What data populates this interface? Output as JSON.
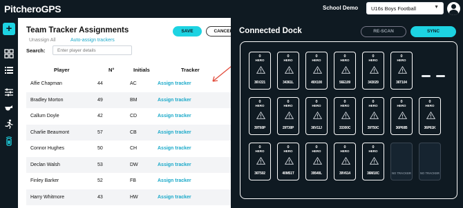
{
  "header": {
    "logo_text": "PitcheroGPS",
    "school": "School Demo",
    "team_selected": "U16s Boys Football"
  },
  "left_panel": {
    "title": "Team Tracker Assignments",
    "save_label": "SAVE",
    "cancel_label": "CANCEL",
    "unassign_label": "Unassign All",
    "auto_assign_label": "Auto-assign trackers",
    "search_label": "Search:",
    "search_placeholder": "Enter player details",
    "columns": [
      "Player",
      "N°",
      "Initials",
      "Tracker"
    ],
    "rows": [
      {
        "player": "Alfie Chapman",
        "number": "44",
        "initials": "AC",
        "tracker": "Assign tracker"
      },
      {
        "player": "Bradley Morton",
        "number": "49",
        "initials": "BM",
        "tracker": "Assign tracker"
      },
      {
        "player": "Callum Doyle",
        "number": "42",
        "initials": "CD",
        "tracker": "Assign tracker"
      },
      {
        "player": "Charlie Beaumont",
        "number": "57",
        "initials": "CB",
        "tracker": "Assign tracker"
      },
      {
        "player": "Connor Hughes",
        "number": "50",
        "initials": "CH",
        "tracker": "Assign tracker"
      },
      {
        "player": "Declan Walsh",
        "number": "53",
        "initials": "DW",
        "tracker": "Assign tracker"
      },
      {
        "player": "Finley Barker",
        "number": "52",
        "initials": "FB",
        "tracker": "Assign tracker"
      },
      {
        "player": "Harry Whitmore",
        "number": "43",
        "initials": "HW",
        "tracker": "Assign tracker"
      }
    ]
  },
  "right_panel": {
    "title": "Connected Dock",
    "rescan_label": "RE-SCAN",
    "sync_label": "SYNC",
    "dock_rows": [
      [
        {
          "id": "0",
          "label": "HERO",
          "serial": "36V221"
        },
        {
          "id": "0",
          "label": "HERO",
          "serial": "34361L"
        },
        {
          "id": "0",
          "label": "HERO",
          "serial": "49X100"
        },
        {
          "id": "0",
          "label": "HERO",
          "serial": "56E109"
        },
        {
          "id": "0",
          "label": "HERO",
          "serial": "343029"
        },
        {
          "id": "0",
          "label": "HERO",
          "serial": "36T104"
        }
      ],
      [
        {
          "id": "0",
          "label": "HERO",
          "serial": "39T60P"
        },
        {
          "id": "0",
          "label": "HERO",
          "serial": "29T30P"
        },
        {
          "id": "0",
          "label": "HERO",
          "serial": "36V11J"
        },
        {
          "id": "0",
          "label": "HERO",
          "serial": "33300C"
        },
        {
          "id": "0",
          "label": "HERO",
          "serial": "39T50C"
        },
        {
          "id": "0",
          "label": "HERO",
          "serial": "36P60B"
        },
        {
          "id": "0",
          "label": "HERO",
          "serial": "36P61K"
        }
      ],
      [
        {
          "id": "0",
          "label": "HERO",
          "serial": "36T502"
        },
        {
          "id": "0",
          "label": "HERO",
          "serial": "40M51T"
        },
        {
          "id": "0",
          "label": "HERO",
          "serial": "39540L"
        },
        {
          "id": "0",
          "label": "HERO",
          "serial": "39V614"
        },
        {
          "id": "0",
          "label": "HERO",
          "serial": "36M10C"
        }
      ]
    ],
    "empty_label": "NO TRACKER"
  },
  "colors": {
    "accent": "#1dd3e2",
    "link": "#1aa9c9",
    "background": "#0f1a22",
    "arrow": "#e24a3a"
  }
}
